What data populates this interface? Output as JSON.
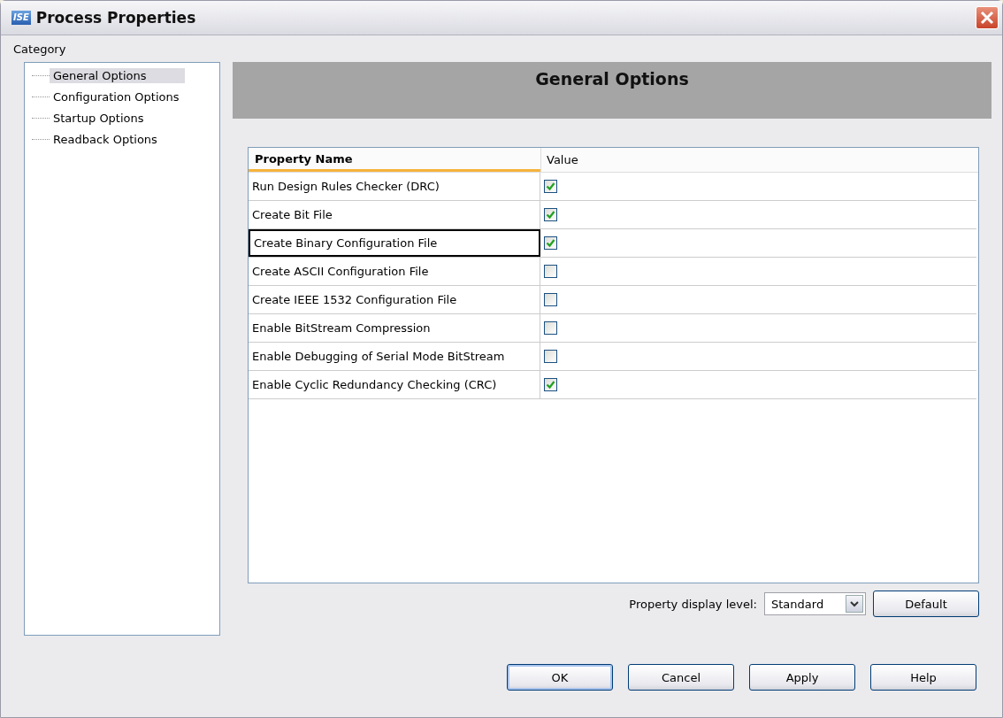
{
  "window": {
    "title": "Process Properties",
    "logo": "ISE"
  },
  "category": {
    "label": "Category",
    "items": [
      {
        "label": "General Options",
        "selected": true
      },
      {
        "label": "Configuration Options",
        "selected": false
      },
      {
        "label": "Startup Options",
        "selected": false
      },
      {
        "label": "Readback Options",
        "selected": false
      }
    ]
  },
  "header": {
    "title": "General Options"
  },
  "table": {
    "columns": [
      "Property Name",
      "Value"
    ],
    "rows": [
      {
        "name": "Run Design Rules Checker (DRC)",
        "checked": true,
        "selected": false
      },
      {
        "name": "Create Bit File",
        "checked": true,
        "selected": false
      },
      {
        "name": "Create Binary Configuration File",
        "checked": true,
        "selected": true
      },
      {
        "name": "Create ASCII Configuration File",
        "checked": false,
        "selected": false
      },
      {
        "name": "Create IEEE 1532 Configuration File",
        "checked": false,
        "selected": false
      },
      {
        "name": "Enable BitStream Compression",
        "checked": false,
        "selected": false
      },
      {
        "name": "Enable Debugging of Serial Mode BitStream",
        "checked": false,
        "selected": false
      },
      {
        "name": "Enable Cyclic Redundancy Checking (CRC)",
        "checked": true,
        "selected": false
      }
    ]
  },
  "display_level": {
    "label": "Property display level:",
    "value": "Standard",
    "button": "Default"
  },
  "buttons": [
    {
      "label": "OK",
      "default": true
    },
    {
      "label": "Cancel",
      "default": false
    },
    {
      "label": "Apply",
      "default": false
    },
    {
      "label": "Help",
      "default": false
    }
  ]
}
